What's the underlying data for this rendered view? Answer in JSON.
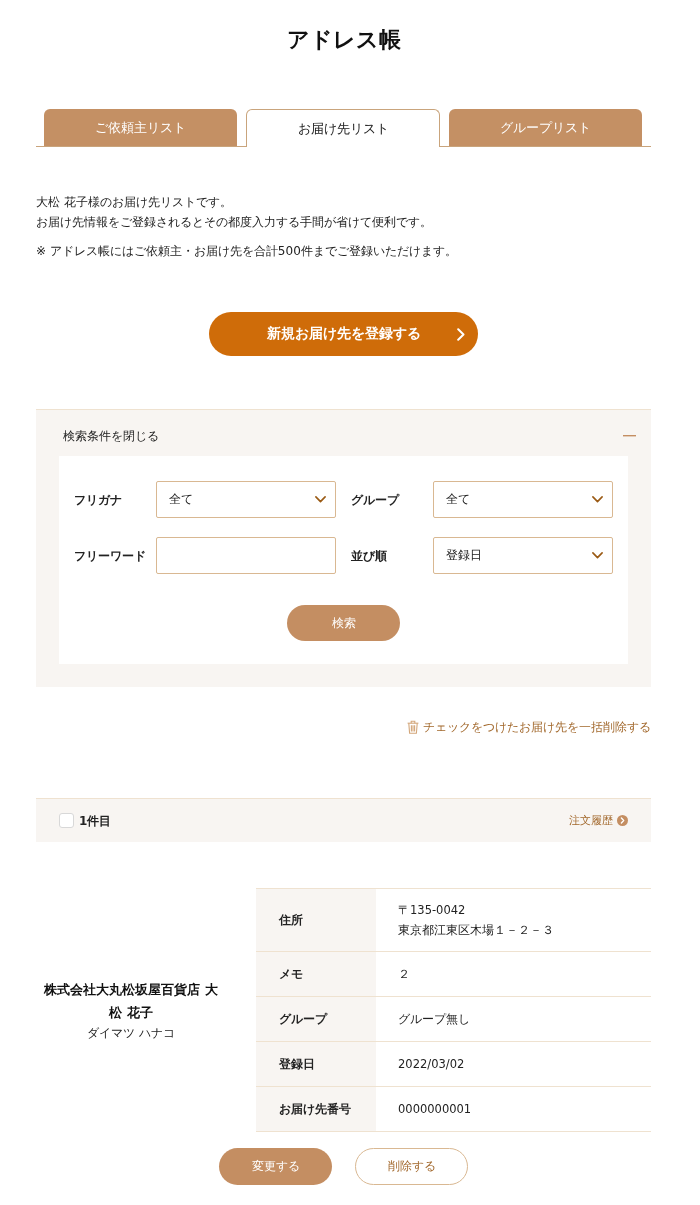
{
  "page_title": "アドレス帳",
  "tabs": [
    {
      "label": "ご依頼主リスト",
      "selected": false
    },
    {
      "label": "お届け先リスト",
      "selected": true
    },
    {
      "label": "グループリスト",
      "selected": false
    }
  ],
  "intro": {
    "lines": [
      "大松 花子様のお届け先リストです。",
      "お届け先情報をご登録されるとその都度入力する手間が省けて便利です。"
    ],
    "note": "※ アドレス帳にはご依頼主・お届け先を合計500件までご登録いただけます。"
  },
  "register_button": "新規お届け先を登録する",
  "search_panel": {
    "toggle_label": "検索条件を閉じる",
    "expanded": true,
    "fields": [
      {
        "label": "フリガナ",
        "kind": "select",
        "value": "全て"
      },
      {
        "label": "グループ",
        "kind": "select",
        "value": "全て"
      },
      {
        "label": "フリーワード",
        "kind": "text"
      },
      {
        "label": "並び順",
        "kind": "select",
        "value": "登録日"
      }
    ],
    "submit_button": "検索"
  },
  "bulk_delete_link": "チェックをつけたお届け先を一括削除する",
  "entries": [
    {
      "header": "1件目",
      "checked": false,
      "history_link": "注文履歴",
      "name": "株式会社大丸松坂屋百貨店 大松 花子",
      "kana": "ダイマツ ハナコ",
      "details": [
        {
          "label": "住所",
          "lines": [
            "〒135-0042",
            "東京都江東区木場１－２－３"
          ]
        },
        {
          "label": "メモ",
          "lines": [
            "２"
          ]
        },
        {
          "label": "グループ",
          "lines": [
            "グループ無し"
          ]
        },
        {
          "label": "登録日",
          "lines": [
            "2022/03/02"
          ]
        },
        {
          "label": "お届け先番号",
          "lines": [
            "0000000001"
          ]
        }
      ],
      "buttons": [
        {
          "label": "変更する",
          "kind": "edit"
        },
        {
          "label": "削除する",
          "kind": "delete"
        }
      ]
    }
  ]
}
